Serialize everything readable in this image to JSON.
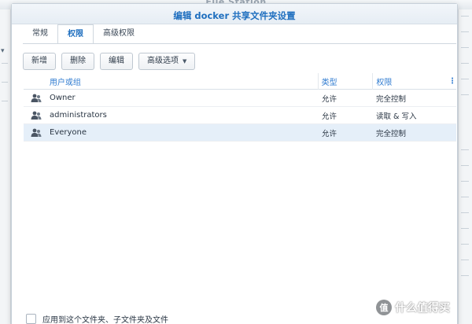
{
  "background": {
    "app_title": "File Station"
  },
  "dialog": {
    "title": "编辑 docker 共享文件夹设置"
  },
  "tabs": [
    {
      "label": "常规",
      "active": false
    },
    {
      "label": "权限",
      "active": true
    },
    {
      "label": "高级权限",
      "active": false
    }
  ],
  "toolbar": {
    "create_label": "新增",
    "delete_label": "删除",
    "edit_label": "编辑",
    "advanced_label": "高级选项"
  },
  "table": {
    "headers": {
      "name": "用户或组",
      "type": "类型",
      "permission": "权限"
    },
    "rows": [
      {
        "name": "Owner",
        "type": "允许",
        "permission": "完全控制",
        "selected": false
      },
      {
        "name": "administrators",
        "type": "允许",
        "permission": "读取 & 写入",
        "selected": false
      },
      {
        "name": "Everyone",
        "type": "允许",
        "permission": "完全控制",
        "selected": true
      }
    ]
  },
  "apply": {
    "label": "应用到这个文件夹、子文件夹及文件",
    "checked": false
  },
  "watermark": {
    "text": "什么值得买",
    "badge": "值"
  },
  "colors": {
    "accent": "#1f6fbf",
    "selected_row": "#e5eff9"
  }
}
